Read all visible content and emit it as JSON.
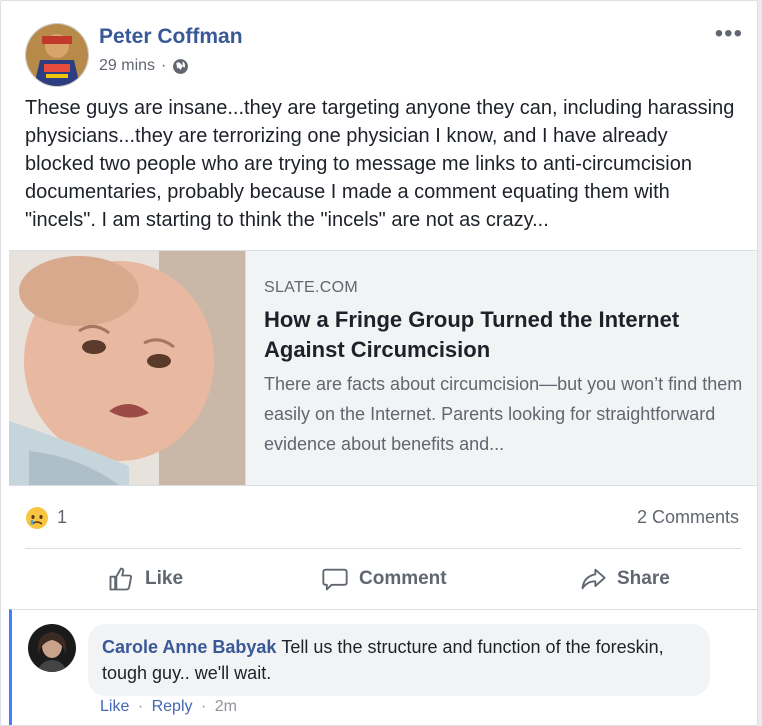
{
  "post": {
    "author": "Peter Coffman",
    "time": "29 mins",
    "separator": "·",
    "more_icon": "ellipsis-icon",
    "text": "These guys are insane...they are targeting anyone they can, including harassing physicians...they are terrorizing one physician I know, and I have already blocked two people who are trying to message me links to anti-circumcision documentaries, probably because I made a comment equating them with \"incels\". I am starting to think the \"incels\" are not as crazy..."
  },
  "link": {
    "source": "SLATE.COM",
    "title": "How a Fringe Group Turned the Internet Against Circumcision",
    "description": "There are facts about circumcision—but you won’t find them easily on the Internet. Parents looking for straightforward evidence about benefits and..."
  },
  "reactions": {
    "icon": "sad-face-icon",
    "count": "1",
    "comments": "2 Comments"
  },
  "actions": {
    "like": "Like",
    "comment": "Comment",
    "share": "Share"
  },
  "comment": {
    "author": "Carole Anne Babyak",
    "text": "Tell us the structure and function of the foreskin, tough guy.. we'll wait.",
    "like": "Like",
    "reply": "Reply",
    "sep": "·",
    "time": "2m"
  },
  "colors": {
    "link_blue": "#385898",
    "accent_border": "#4080ff",
    "muted": "#606770"
  }
}
